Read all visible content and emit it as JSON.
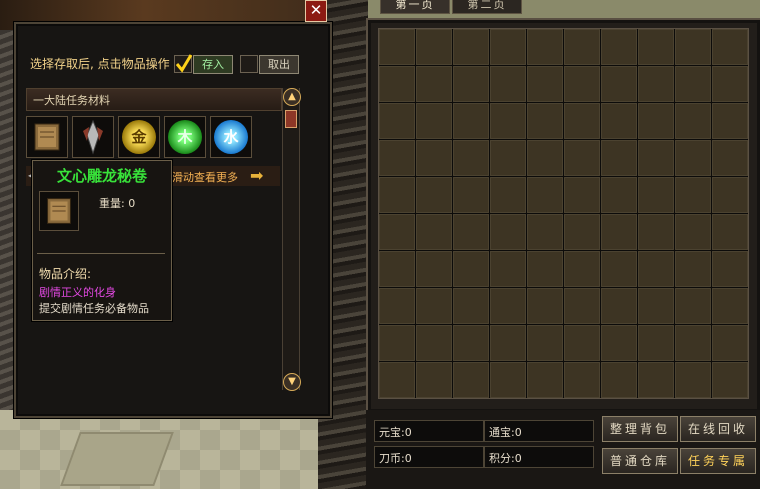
{
  "storage": {
    "instruction": "选择存取后, 点击物品操作",
    "deposit_label": "存入",
    "withdraw_label": "取出",
    "close_symbol": "✕",
    "category": "一大陆任务材料",
    "scroll_hint": "滑动查看更多",
    "items": [
      {
        "icon": "book-icon"
      },
      {
        "icon": "spear-icon"
      },
      {
        "icon": "gold-orb-icon",
        "glyph": "金"
      },
      {
        "icon": "wood-orb-icon",
        "glyph": "木"
      },
      {
        "icon": "water-orb-icon",
        "glyph": "水"
      }
    ]
  },
  "tooltip": {
    "title": "文心雕龙秘卷",
    "weight": "重量: 0",
    "section": "物品介绍:",
    "flavor": "剧情正义的化身",
    "description": "提交剧情任务必备物品"
  },
  "bag": {
    "tabs": [
      "第一页",
      "第二页"
    ],
    "rows": 10,
    "cols": 10,
    "currency": {
      "yuanbao": "元宝:0",
      "tongbao": "通宝:0",
      "daobi": "刀币:0",
      "jifen": "积分:0"
    },
    "buttons": {
      "sort": "整理背包",
      "recycle": "在线回收",
      "warehouse": "普通仓库",
      "quest": "任务专属"
    }
  },
  "colors": {
    "accent_green": "#38e23a",
    "accent_gold": "#f5b254",
    "flavor_magenta": "#e349e3",
    "close_red": "#8c1a12"
  }
}
